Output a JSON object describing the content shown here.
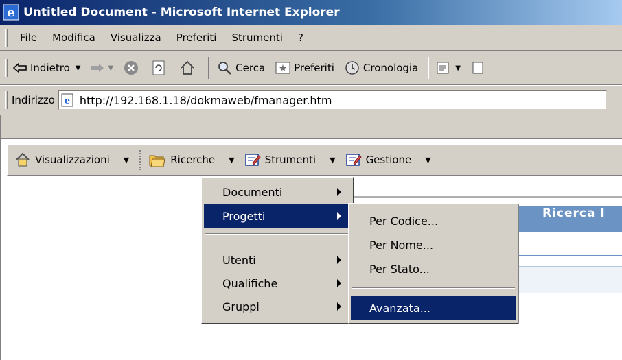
{
  "window": {
    "title": "Untitled Document - Microsoft Internet Explorer"
  },
  "menubar": {
    "items": [
      "File",
      "Modifica",
      "Visualizza",
      "Preferiti",
      "Strumenti",
      "?"
    ]
  },
  "toolbar": {
    "back_label": "Indietro",
    "search_label": "Cerca",
    "favorites_label": "Preferiti",
    "history_label": "Cronologia"
  },
  "address": {
    "label": "Indirizzo",
    "url": "http://192.168.1.18/dokmaweb/fmanager.htm"
  },
  "appbar": {
    "views": "Visualizzazioni",
    "searches": "Ricerche",
    "tools": "Strumenti",
    "management": "Gestione"
  },
  "ricerche_menu": {
    "items": [
      "Documenti",
      "Progetti",
      "Utenti",
      "Qualifiche",
      "Gruppi"
    ],
    "selected": "Progetti"
  },
  "progetti_submenu": {
    "items": [
      "Per Codice...",
      "Per Nome...",
      "Per Stato...",
      "Avanzata..."
    ],
    "selected": "Avanzata..."
  },
  "background": {
    "panel_title": "Ricerca I"
  },
  "colors": {
    "title_bar": "#0a246a",
    "menu_highlight": "#0a246a",
    "panel_header": "#6b93c4",
    "chrome": "#d4d0c8"
  }
}
